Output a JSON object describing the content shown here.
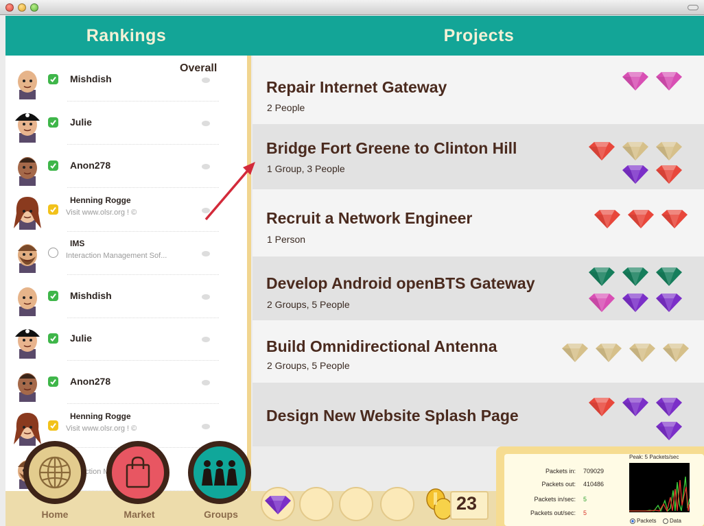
{
  "header": {
    "rankings_title": "Rankings",
    "projects_title": "Projects"
  },
  "rankings": {
    "overall_label": "Overall",
    "rows": [
      {
        "name": "Mishdish",
        "status": "online",
        "avatar": "bald-avatar",
        "subtitle": ""
      },
      {
        "name": "Julie",
        "status": "online",
        "avatar": "pirate-avatar",
        "subtitle": ""
      },
      {
        "name": "Anon278",
        "status": "online",
        "avatar": "dark-skin-avatar",
        "subtitle": ""
      },
      {
        "name": "Henning Rogge",
        "status": "away",
        "avatar": "redhead-avatar",
        "subtitle": "Visit www.olsr.org ! ©"
      },
      {
        "name": "IMS",
        "status": "offline",
        "avatar": "bearded-avatar",
        "subtitle": "Interaction Management Sof..."
      },
      {
        "name": "Mishdish",
        "status": "online",
        "avatar": "bald-avatar",
        "subtitle": ""
      },
      {
        "name": "Julie",
        "status": "online",
        "avatar": "pirate-avatar",
        "subtitle": ""
      },
      {
        "name": "Anon278",
        "status": "online",
        "avatar": "dark-skin-avatar",
        "subtitle": ""
      },
      {
        "name": "Henning Rogge",
        "status": "away",
        "avatar": "redhead-avatar",
        "subtitle": "Visit www.olsr.org ! ©"
      },
      {
        "name": "",
        "status": "offline",
        "avatar": "bearded-avatar",
        "subtitle": "Interaction Management Sof..."
      }
    ]
  },
  "projects": [
    {
      "title": "Repair Internet Gateway",
      "members": "2 People",
      "gems": [
        "pink",
        "pink"
      ]
    },
    {
      "title": "Bridge Fort Greene to Clinton Hill",
      "members": "1 Group, 3 People",
      "gems": [
        "red",
        "tan",
        "tan",
        "purple",
        "red"
      ]
    },
    {
      "title": "Recruit a Network Engineer",
      "members": "1 Person",
      "gems": [
        "red",
        "red",
        "red"
      ]
    },
    {
      "title": "Develop Android openBTS Gateway",
      "members": "2 Groups, 5 People",
      "gems": [
        "green",
        "green",
        "green",
        "pink",
        "purple",
        "purple"
      ]
    },
    {
      "title": "Build Omnidirectional Antenna",
      "members": "2 Groups, 5 People",
      "gems": [
        "tan",
        "tan",
        "tan",
        "tan"
      ]
    },
    {
      "title": "Design New Website Splash Page",
      "members": "",
      "gems": [
        "red",
        "purple",
        "purple",
        "purple"
      ]
    }
  ],
  "nav": {
    "home_label": "Home",
    "market_label": "Market",
    "groups_label": "Groups"
  },
  "inventory": {
    "slots": [
      "purple",
      "empty",
      "empty",
      "empty"
    ],
    "coins": "23"
  },
  "stats": {
    "peak": "Peak: 5 Packets/sec",
    "packets_in_label": "Packets in:",
    "packets_in": "709029",
    "packets_out_label": "Packets out:",
    "packets_out": "410486",
    "packets_in_sec_label": "Packets in/sec:",
    "packets_in_sec": "5",
    "packets_out_sec_label": "Packets out/sec:",
    "packets_out_sec": "5",
    "radio_packets": "Packets",
    "radio_data": "Data",
    "selected_mode": "Packets"
  },
  "colors": {
    "header": "#13a597",
    "gem_pink": "#d84fb4",
    "gem_red": "#e8473b",
    "gem_tan": "#d6c08a",
    "gem_purple": "#7b2fc8",
    "gem_green": "#167e5c",
    "in_line": "#3cd13c",
    "out_line": "#e3342a"
  }
}
